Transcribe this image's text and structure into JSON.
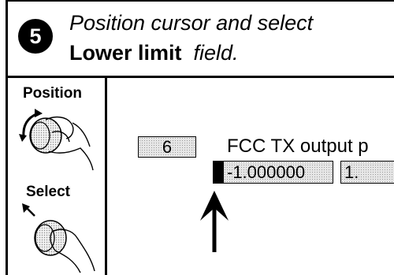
{
  "step": {
    "number": "5"
  },
  "instruction": {
    "line1": "Position cursor and select",
    "field_name": "Lower limit",
    "field_suffix": "field."
  },
  "controls": {
    "position_label": "Position",
    "select_label": "Select"
  },
  "screen": {
    "test_number": "6",
    "test_label": "FCC TX output p",
    "lower_limit": "-1.000000",
    "upper_limit": "1."
  },
  "icons": {
    "position_knob": "rotary-knob-turn-icon",
    "select_knob": "rotary-knob-press-icon",
    "cursor_pointer": "up-arrow-icon"
  },
  "colors": {
    "field_fill": "#e6e6e6",
    "ink": "#000000"
  }
}
